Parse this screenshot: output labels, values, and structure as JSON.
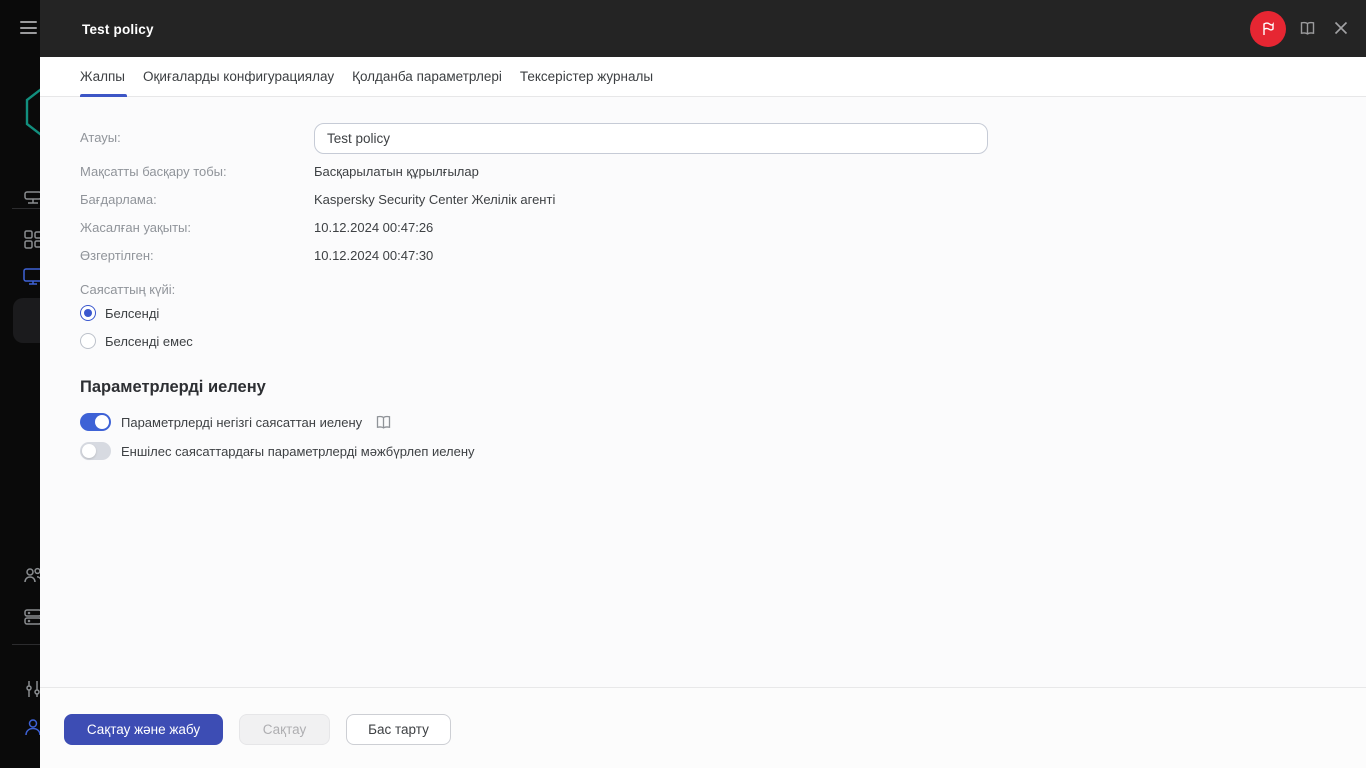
{
  "header": {
    "title": "Test policy",
    "icons": [
      "notification-flag",
      "help-book",
      "close"
    ]
  },
  "sidebar": {
    "icons": [
      "menu",
      "kaspersky-logo",
      "administration-server",
      "discovery-deployment",
      "devices",
      "users-roles",
      "repositories",
      "console-settings",
      "account"
    ]
  },
  "tabs": [
    {
      "label": "Жалпы",
      "active": true
    },
    {
      "label": "Оқиғаларды конфигурациялау",
      "active": false
    },
    {
      "label": "Қолданба параметрлері",
      "active": false
    },
    {
      "label": "Тексерістер журналы",
      "active": false
    }
  ],
  "form": {
    "name_label": "Атауы:",
    "name_value": "Test policy",
    "rows": [
      {
        "label": "Мақсатты басқару тобы:",
        "value": "Басқарылатын құрылғылар"
      },
      {
        "label": "Бағдарлама:",
        "value": "Kaspersky Security Center Желілік агенті"
      },
      {
        "label": "Жасалған уақыты:",
        "value": "10.12.2024 00:47:26"
      },
      {
        "label": "Өзгертілген:",
        "value": "10.12.2024 00:47:30"
      }
    ],
    "status_label": "Саясаттың күйі:",
    "radios": [
      {
        "label": "Белсенді",
        "selected": true
      },
      {
        "label": "Белсенді емес",
        "selected": false
      }
    ],
    "inherit_heading": "Параметрлерді иелену",
    "toggles": [
      {
        "label": "Параметрлерді негізгі саясаттан иелену",
        "on": true,
        "has_help_icon": true
      },
      {
        "label": "Еншілес саясаттардағы параметрлерді мәжбүрлеп иелену",
        "on": false,
        "has_help_icon": false
      }
    ]
  },
  "footer": {
    "save_close_label": "Сақтау және жабу",
    "save_label": "Сақтау",
    "cancel_label": "Бас тарту"
  },
  "colors": {
    "accent_indigo": "#3d4db4",
    "accent_blue": "#3e62d6",
    "tab_underline": "#3d56c6",
    "badge_red": "#e62632",
    "logo_teal": "#128f7e",
    "header_dark": "#242424",
    "sidebar_black": "#0a0a0a"
  }
}
